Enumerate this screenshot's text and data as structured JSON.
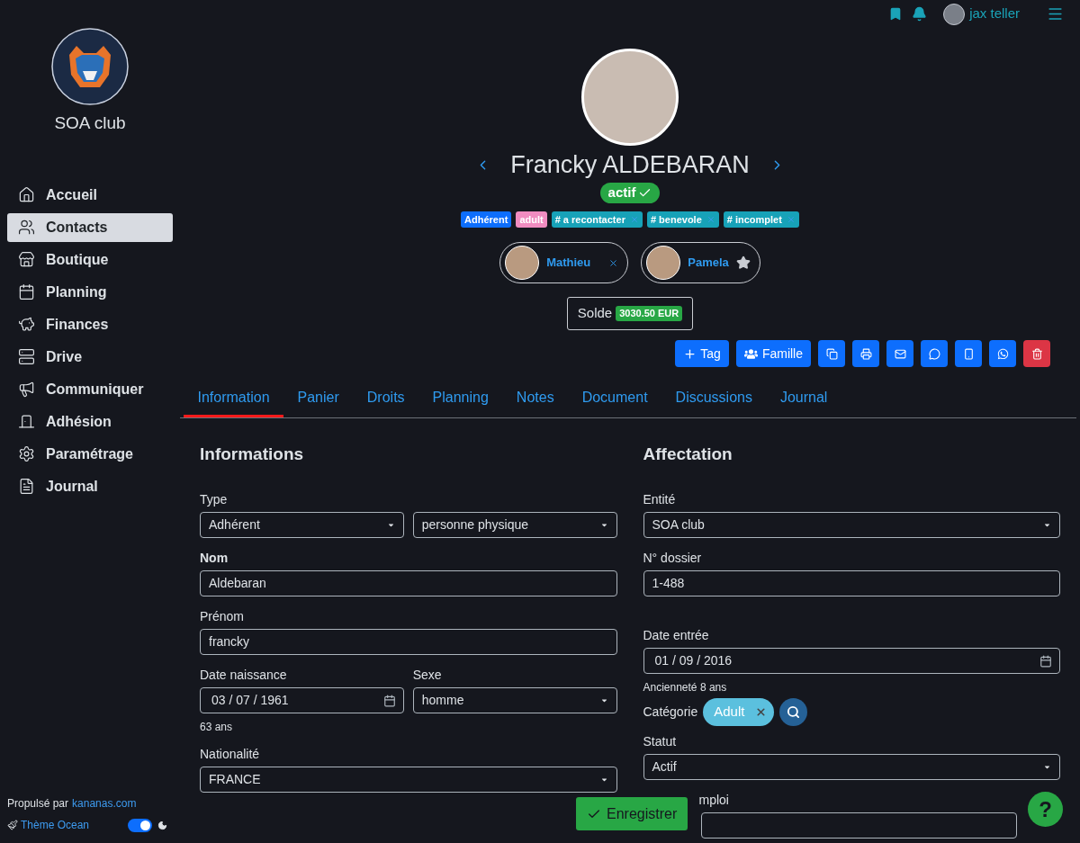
{
  "topbar": {
    "user": "jax teller"
  },
  "sidebar": {
    "club_name": "SOA club",
    "items": [
      {
        "label": "Accueil",
        "selected": false
      },
      {
        "label": "Contacts",
        "selected": true
      },
      {
        "label": "Boutique",
        "selected": false
      },
      {
        "label": "Planning",
        "selected": false
      },
      {
        "label": "Finances",
        "selected": false
      },
      {
        "label": "Drive",
        "selected": false
      },
      {
        "label": "Communiquer",
        "selected": false
      },
      {
        "label": "Adhésion",
        "selected": false
      },
      {
        "label": "Paramétrage",
        "selected": false
      },
      {
        "label": "Journal",
        "selected": false
      }
    ],
    "footer": {
      "powered_by": "Propulsé par",
      "link": "kananas.com",
      "theme": "Thème Ocean",
      "dark_mode_on": true
    }
  },
  "profile": {
    "name": "Francky ALDEBARAN",
    "status": "actif",
    "tags": [
      {
        "label": "Adhérent",
        "color": "#0d6efd",
        "removable": false
      },
      {
        "label": "adult",
        "color": "#f08cc0",
        "removable": false
      },
      {
        "label": "# a recontacter",
        "color": "#17a2b8",
        "removable": true
      },
      {
        "label": "# benevole",
        "color": "#17a2b8",
        "removable": true
      },
      {
        "label": "# incomplet",
        "color": "#17a2b8",
        "removable": true
      }
    ],
    "family": [
      {
        "name": "Mathieu",
        "kind": "remove"
      },
      {
        "name": "Pamela",
        "kind": "star"
      }
    ],
    "balance": {
      "label": "Solde",
      "amount": "3030.50 EUR"
    }
  },
  "actions": [
    {
      "kind": "tag",
      "label": "Tag"
    },
    {
      "kind": "family",
      "label": "Famille"
    },
    {
      "kind": "copy"
    },
    {
      "kind": "print"
    },
    {
      "kind": "mail"
    },
    {
      "kind": "comment"
    },
    {
      "kind": "mobile"
    },
    {
      "kind": "whatsapp"
    },
    {
      "kind": "delete"
    }
  ],
  "tabs": [
    {
      "label": "Information",
      "selected": true
    },
    {
      "label": "Panier",
      "selected": false
    },
    {
      "label": "Droits",
      "selected": false
    },
    {
      "label": "Planning",
      "selected": false
    },
    {
      "label": "Notes",
      "selected": false
    },
    {
      "label": "Document",
      "selected": false
    },
    {
      "label": "Discussions",
      "selected": false
    },
    {
      "label": "Journal",
      "selected": false
    }
  ],
  "informations": {
    "title": "Informations",
    "type": {
      "label": "Type",
      "value": "Adhérent",
      "value_2": "personne physique"
    },
    "nom": {
      "label": "Nom",
      "value": "Aldebaran"
    },
    "prenom": {
      "label": "Prénom",
      "value": "francky"
    },
    "birth": {
      "label": "Date naissance",
      "value": "03 / 07 / 1961",
      "hint": "63 ans"
    },
    "sexe": {
      "label": "Sexe",
      "value": "homme"
    },
    "nationalite": {
      "label": "Nationalité",
      "value": "FRANCE"
    }
  },
  "affectation": {
    "title": "Affectation",
    "entite": {
      "label": "Entité",
      "value": "SOA club"
    },
    "dossier": {
      "label": "N° dossier",
      "value": "1-488"
    },
    "entry": {
      "label": "Date entrée",
      "value": "01 / 09 / 2016",
      "hint": "Ancienneté 8 ans"
    },
    "categorie": {
      "label": "Catégorie",
      "chip": "Adult"
    },
    "statut": {
      "label": "Statut",
      "value": "Actif"
    },
    "emploi": {
      "label": "mploi"
    }
  },
  "save_button": "Enregistrer",
  "help_button": "?"
}
